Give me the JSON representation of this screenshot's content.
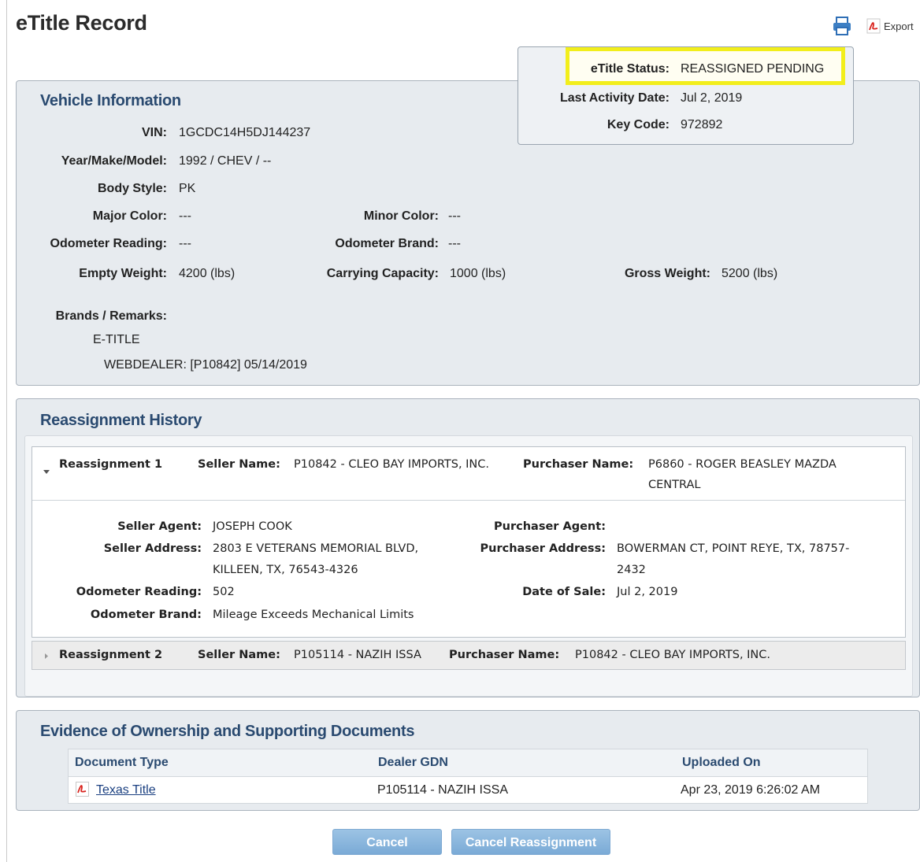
{
  "page": {
    "title": "eTitle Record",
    "export_label": "Export"
  },
  "status": {
    "etitle_status_label": "eTitle Status:",
    "etitle_status_value": "REASSIGNED PENDING",
    "last_activity_label": "Last Activity Date:",
    "last_activity_value": "Jul 2, 2019",
    "key_code_label": "Key Code:",
    "key_code_value": "972892",
    "highlight_color": "#f2ee1b"
  },
  "vehicle": {
    "heading": "Vehicle Information",
    "vin_label": "VIN:",
    "vin": "1GCDC14H5DJ144237",
    "ymm_label": "Year/Make/Model:",
    "ymm": "1992 / CHEV / --",
    "body_style_label": "Body Style:",
    "body_style": "PK",
    "major_color_label": "Major Color:",
    "major_color": "---",
    "minor_color_label": "Minor Color:",
    "minor_color": "---",
    "odometer_reading_label": "Odometer Reading:",
    "odometer_reading": "---",
    "odometer_brand_label": "Odometer Brand:",
    "odometer_brand": "---",
    "empty_weight_label": "Empty Weight:",
    "empty_weight": "4200 (lbs)",
    "carrying_capacity_label": "Carrying Capacity:",
    "carrying_capacity": "1000 (lbs)",
    "gross_weight_label": "Gross Weight:",
    "gross_weight": "5200 (lbs)",
    "brands_label": "Brands / Remarks:",
    "brands": [
      "E-TITLE",
      "WEBDEALER: [P10842] 05/14/2019"
    ]
  },
  "reassignment_history": {
    "heading": "Reassignment History",
    "items": [
      {
        "title": "Reassignment 1",
        "seller_name_label": "Seller Name:",
        "seller_name": "P10842 - CLEO BAY IMPORTS, INC.",
        "purchaser_name_label": "Purchaser Name:",
        "purchaser_name_line1": "P6860 - ROGER BEASLEY MAZDA",
        "purchaser_name_line2": "CENTRAL",
        "seller_agent_label": "Seller Agent:",
        "seller_agent": "JOSEPH COOK",
        "seller_address_label": "Seller Address:",
        "seller_address_line1": "2803 E VETERANS MEMORIAL BLVD,",
        "seller_address_line2": "KILLEEN, TX, 76543-4326",
        "odometer_reading_label": "Odometer Reading:",
        "odometer_reading": "502",
        "odometer_brand_label": "Odometer Brand:",
        "odometer_brand": "Mileage Exceeds Mechanical Limits",
        "purchaser_agent_label": "Purchaser Agent:",
        "purchaser_agent": "",
        "purchaser_address_label": "Purchaser Address:",
        "purchaser_address_line1": "BOWERMAN CT, POINT REYE, TX, 78757-",
        "purchaser_address_line2": "2432",
        "date_of_sale_label": "Date of Sale:",
        "date_of_sale": "Jul 2, 2019"
      },
      {
        "title": "Reassignment 2",
        "seller_name_label": "Seller Name:",
        "seller_name": "P105114 - NAZIH ISSA",
        "purchaser_name_label": "Purchaser Name:",
        "purchaser_name": "P10842 - CLEO BAY IMPORTS, INC."
      }
    ]
  },
  "documents": {
    "heading": "Evidence of Ownership and Supporting Documents",
    "columns": [
      "Document Type",
      "Dealer GDN",
      "Uploaded On"
    ],
    "rows": [
      {
        "document_type": "Texas Title",
        "dealer_gdn": "P105114 - NAZIH ISSA",
        "uploaded_on": "Apr 23, 2019 6:26:02 AM"
      }
    ]
  },
  "buttons": {
    "cancel": "Cancel",
    "cancel_reassignment": "Cancel Reassignment"
  }
}
